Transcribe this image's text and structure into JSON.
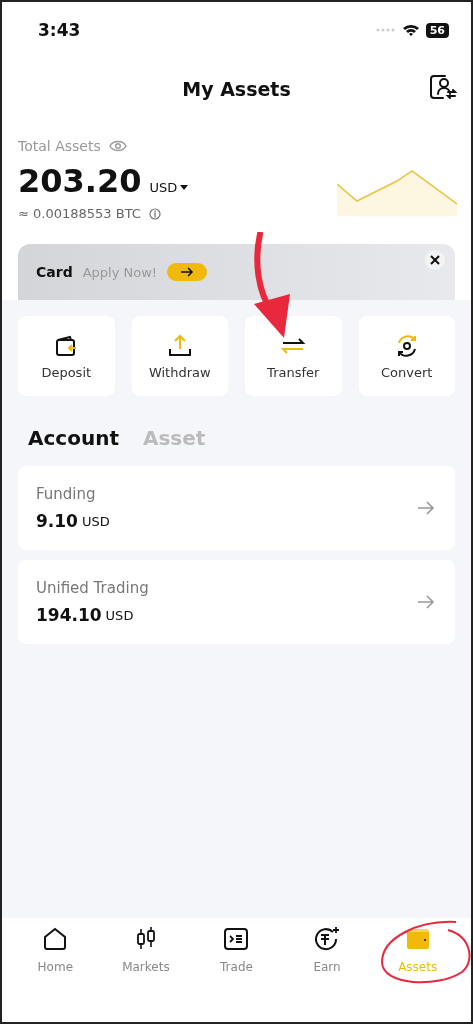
{
  "status_bar": {
    "time": "3:43",
    "battery": "56"
  },
  "header": {
    "title": "My Assets"
  },
  "total": {
    "label": "Total Assets",
    "amount": "203.20",
    "currency": "USD",
    "btc": "≈ 0.00188553 BTC"
  },
  "banner": {
    "title": "Card",
    "subtitle": "Apply Now!"
  },
  "actions": [
    {
      "label": "Deposit",
      "kind": "deposit"
    },
    {
      "label": "Withdraw",
      "kind": "withdraw"
    },
    {
      "label": "Transfer",
      "kind": "transfer"
    },
    {
      "label": "Convert",
      "kind": "convert"
    }
  ],
  "tabs": [
    {
      "label": "Account",
      "selected": true
    },
    {
      "label": "Asset",
      "selected": false
    }
  ],
  "accounts": [
    {
      "name": "Funding",
      "amount": "9.10",
      "currency": "USD"
    },
    {
      "name": "Unified Trading",
      "amount": "194.10",
      "currency": "USD"
    }
  ],
  "nav": [
    {
      "label": "Home",
      "kind": "home",
      "selected": false
    },
    {
      "label": "Markets",
      "kind": "markets",
      "selected": false
    },
    {
      "label": "Trade",
      "kind": "trade",
      "selected": false
    },
    {
      "label": "Earn",
      "kind": "earn",
      "selected": false
    },
    {
      "label": "Assets",
      "kind": "assets",
      "selected": true
    }
  ]
}
